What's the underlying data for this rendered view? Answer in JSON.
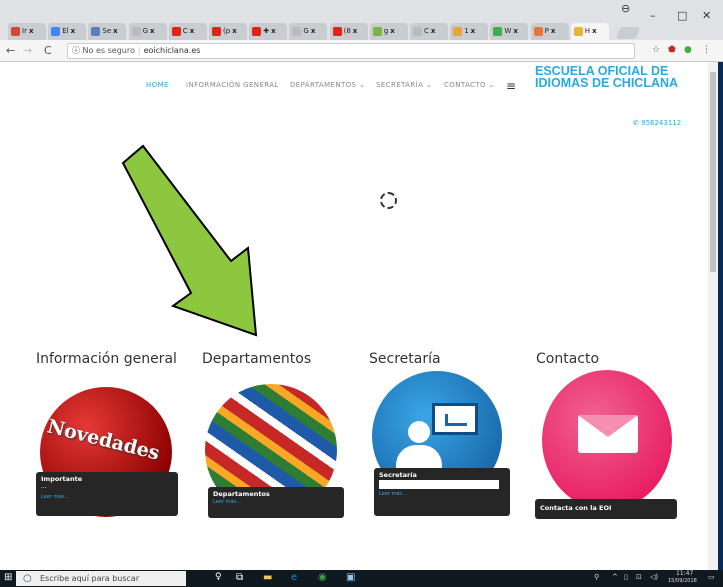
{
  "browser": {
    "tabs": [
      {
        "label": "Ir",
        "color": "#d44638"
      },
      {
        "label": "El",
        "color": "#4285f4"
      },
      {
        "label": "Se",
        "color": "#5b7fb8"
      },
      {
        "label": "G",
        "color": "#bbbbbb"
      },
      {
        "label": "C",
        "color": "#e62117"
      },
      {
        "label": "(p",
        "color": "#e62117"
      },
      {
        "label": "✚",
        "color": "#e62117"
      },
      {
        "label": "G",
        "color": "#bbbbbb"
      },
      {
        "label": "(8",
        "color": "#e62117"
      },
      {
        "label": "g",
        "color": "#7cb342"
      },
      {
        "label": "C",
        "color": "#bbbbbb"
      },
      {
        "label": "1",
        "color": "#e8a33d"
      },
      {
        "label": "W",
        "color": "#3fae49"
      },
      {
        "label": "P",
        "color": "#e8733d"
      },
      {
        "label": "H",
        "color": "#e8b33d"
      }
    ],
    "security_text": "No es seguro",
    "url": "eoichiclana.es"
  },
  "site": {
    "menu": [
      "HOME",
      "INFORMACIÓN GENERAL",
      "DEPARTAMENTOS ⌄",
      "SECRETARÍA ⌄",
      "CONTACTO ⌄"
    ],
    "brand": "ESCUELA OFICIAL DE IDIOMAS DE CHICLANA",
    "phone": "956243112",
    "sections": [
      "Información general",
      "Departamentos",
      "Secretaría",
      "Contacto"
    ],
    "cards": [
      {
        "title": "Importante",
        "sub": "...",
        "more": "Leer más..."
      },
      {
        "title": "Departamentos",
        "more": "Leer más..."
      },
      {
        "title": "Secretaría",
        "more": "Leer más..."
      },
      {
        "title": "Contacta con la EOI"
      }
    ],
    "novedades": "Novedades",
    "annotation_arrow_color": "#8dc63f"
  },
  "taskbar": {
    "search_placeholder": "Escribe aquí para buscar",
    "time": "11:47",
    "date": "15/09/2018"
  }
}
